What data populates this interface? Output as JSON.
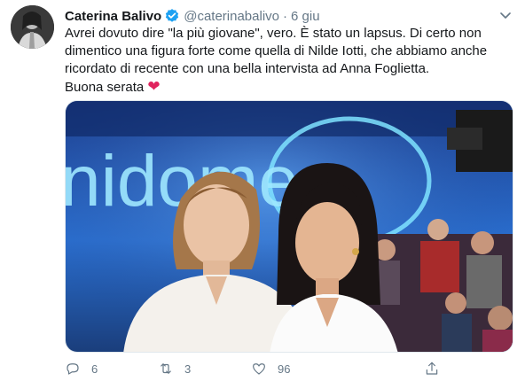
{
  "tweet": {
    "author_name": "Caterina Balivo",
    "handle": "@caterinabalivo",
    "separator": "·",
    "time": "6 giu",
    "text_lines": [
      "Avrei dovuto dire \"la più giovane\", vero. È stato un lapsus. Di certo non dimentico una figura forte come quella di Nilde Iotti, che abbiamo anche ricordato di recente con una bella intervista ad Anna Foglietta.",
      "Buona serata"
    ],
    "heart_emoji": "❤"
  },
  "media": {
    "screen_text": "nidome"
  },
  "actions": {
    "replies": "6",
    "retweets": "3",
    "likes": "96"
  },
  "icons": {
    "verified": "verified-badge-icon",
    "caret": "chevron-down-icon",
    "reply": "reply-icon",
    "retweet": "retweet-icon",
    "like": "heart-icon",
    "share": "share-icon"
  },
  "colors": {
    "text": "#14171a",
    "secondary": "#657786",
    "verified": "#1da1f2",
    "heart": "#e0245e"
  }
}
